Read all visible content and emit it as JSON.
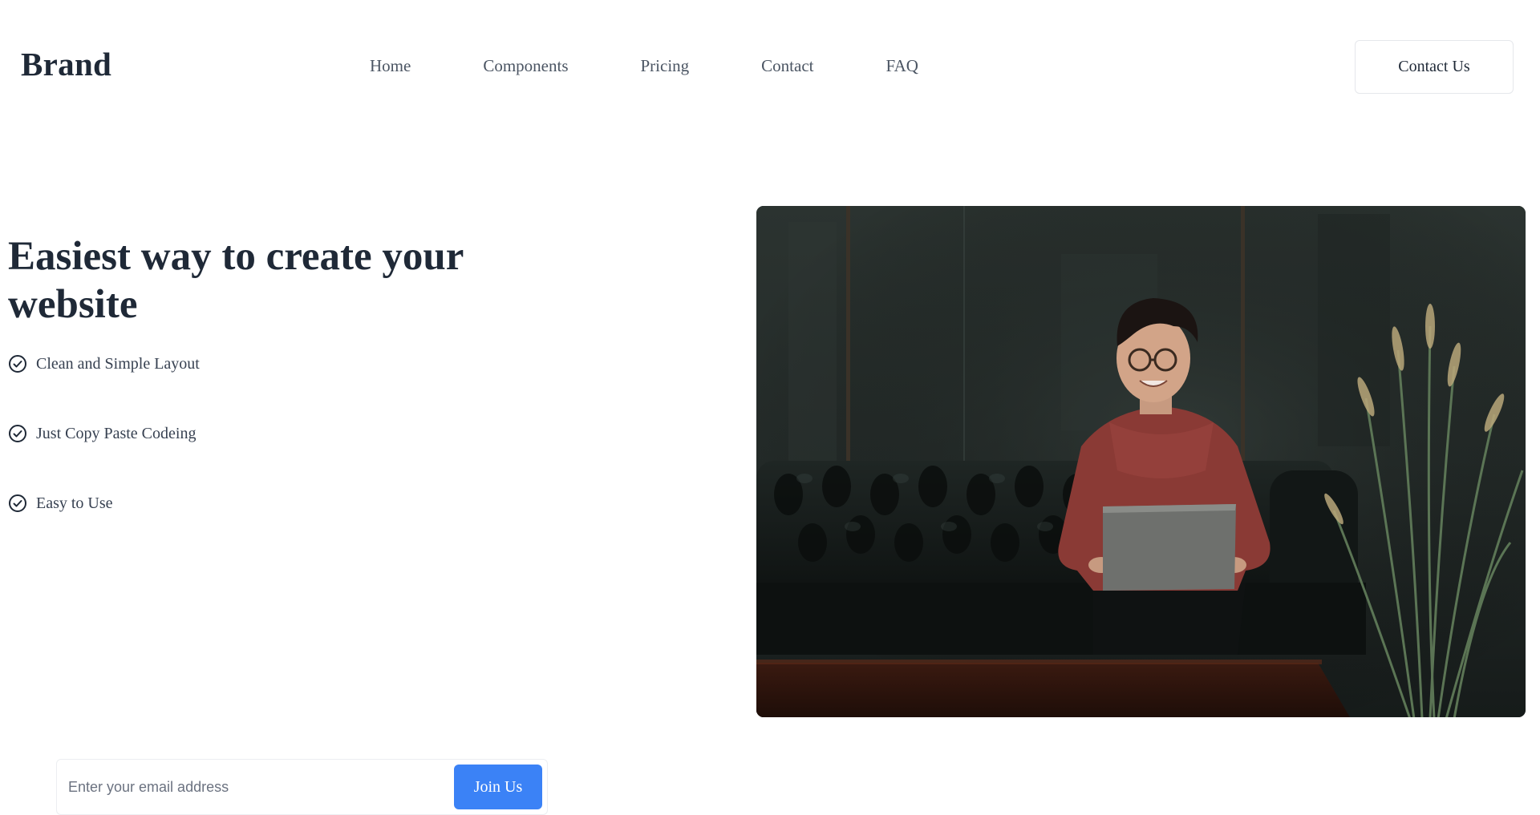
{
  "brand": "Brand",
  "nav": {
    "items": [
      {
        "label": "Home"
      },
      {
        "label": "Components"
      },
      {
        "label": "Pricing"
      },
      {
        "label": "Contact"
      },
      {
        "label": "FAQ"
      }
    ],
    "cta_label": "Contact Us"
  },
  "hero": {
    "title": "Easiest way to create your website",
    "features": [
      {
        "label": "Clean and Simple Layout",
        "icon": "check-circle-icon"
      },
      {
        "label": "Just Copy Paste Codeing",
        "icon": "check-circle-icon"
      },
      {
        "label": "Easy to Use",
        "icon": "check-circle-icon"
      }
    ],
    "image_alt": "Person smiling on a leather sofa with a laptop"
  },
  "signup": {
    "email_placeholder": "Enter your email address",
    "email_value": "",
    "join_label": "Join Us"
  },
  "colors": {
    "accent": "#3b82f6",
    "text_dark": "#1f2937",
    "text_muted": "#4b5563"
  }
}
